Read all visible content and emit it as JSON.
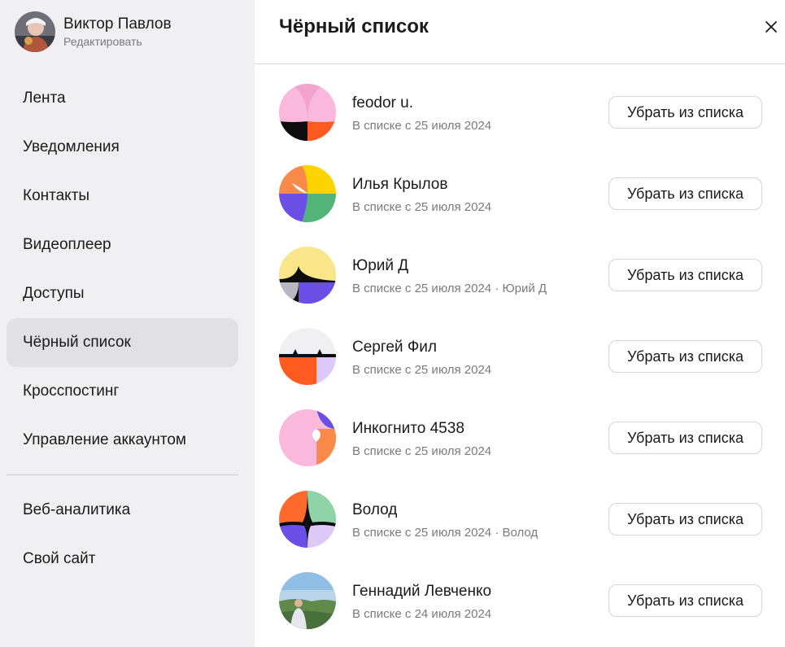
{
  "profile": {
    "name": "Виктор Павлов",
    "edit_label": "Редактировать"
  },
  "nav": {
    "items": [
      "Лента",
      "Уведомления",
      "Контакты",
      "Видеоплеер",
      "Доступы",
      "Чёрный список",
      "Кросспостинг",
      "Управление аккаунтом"
    ],
    "active": "Чёрный список",
    "extra_items": [
      "Веб-аналитика",
      "Свой сайт"
    ]
  },
  "header": {
    "title": "Чёрный список",
    "close_icon": "close-icon"
  },
  "blocked": {
    "button_label": "Убрать из списка",
    "users": [
      {
        "name": "feodor u.",
        "subtitle": "В списке с 25 июля 2024",
        "avatar": "pattern-pink-black-orange"
      },
      {
        "name": "Илья Крылов",
        "subtitle": "В списке с 25 июля 2024",
        "avatar": "pattern-orange-yellow-purple-green"
      },
      {
        "name": "Юрий Д",
        "subtitle": "В списке с 25 июля 2024 · Юрий Д",
        "avatar": "pattern-yellow-black-purple"
      },
      {
        "name": "Сергей Фил",
        "subtitle": "В списке с 25 июля 2024",
        "avatar": "pattern-white-orange-lavender"
      },
      {
        "name": "Инкогнито 4538",
        "subtitle": "В списке с 25 июля 2024",
        "avatar": "pattern-pink-purple-orange"
      },
      {
        "name": "Волод",
        "subtitle": "В списке с 25 июля 2024 · Волод",
        "avatar": "pattern-orange-green-purple"
      },
      {
        "name": "Геннадий Левченко",
        "subtitle": "В списке с 24 июля 2024",
        "avatar": "photo-landscape"
      }
    ]
  },
  "colors": {
    "sidebar_bg": "#f0f0f2",
    "active_bg": "#e1e1e5",
    "pink": "#f9b8dc",
    "orange": "#ff5a1f",
    "orange_light": "#f98a4a",
    "yellow": "#fdd400",
    "yellow_light": "#fbe58a",
    "purple": "#6b4ee6",
    "lavender": "#dcc9f7",
    "green": "#53b47a",
    "green_light": "#8fd3a6",
    "black": "#0d0d0d"
  }
}
